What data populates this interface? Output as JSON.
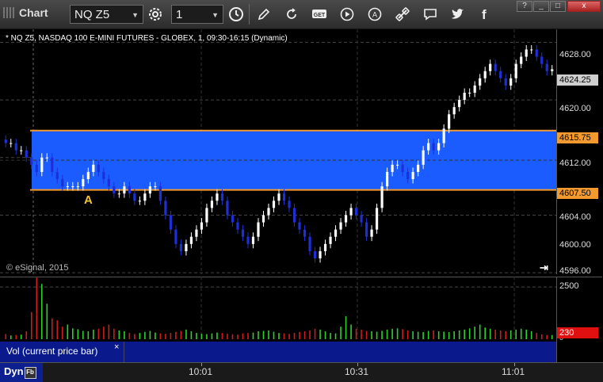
{
  "window": {
    "title": "Chart",
    "symbol": "NQ Z5",
    "interval": "1",
    "controls": {
      "help": "?",
      "minimize": "_",
      "maximize": "□",
      "close": "x"
    },
    "toolbar_icons": [
      "gear-icon",
      "clock-icon",
      "pencil-icon",
      "refresh-icon",
      "get-icon",
      "play-icon",
      "replay-icon",
      "link-icon",
      "comment-icon",
      "twitter-icon",
      "facebook-icon"
    ],
    "toolbar_icon_texts": {
      "get": "GET",
      "replay": "A",
      "facebook": "f"
    }
  },
  "chart": {
    "header": "* NQ Z5, NASDAQ 100 E-MINI FUTURES - GLOBEX, 1, 09:30-16:15 (Dynamic)",
    "copyright": "© eSignal, 2015",
    "marker_label": "A",
    "pan_icon": "⇥",
    "price_scale": [
      "4628.00",
      "4620.00",
      "4612.00",
      "4604.00",
      "4600.00",
      "4596.00"
    ],
    "current_price": "4624.25",
    "level_high": "4615.75",
    "level_low": "4607.50",
    "volume_scale": [
      "2500",
      "0"
    ],
    "current_volume": "230",
    "time_labels": [
      "10:01",
      "10:31",
      "11:01"
    ],
    "colors": {
      "zone": "#1a5cff",
      "level_line": "#f39a2e",
      "up_candle": "#ffffff",
      "down_candle": "#1f2fd8",
      "vol_up": "#2cd12c",
      "vol_down": "#d11b1b"
    }
  },
  "chart_data": {
    "type": "candlestick",
    "y_range": [
      4595.8,
      4629.8
    ],
    "volume_range": [
      0,
      3000
    ],
    "open_range_high": 4615.75,
    "open_range_low": 4607.5,
    "bar_count": 105,
    "closes": [
      4614,
      4614,
      4613,
      4613,
      4612,
      4611,
      4610,
      4612,
      4612,
      4610,
      4609,
      4608,
      4608,
      4608,
      4608,
      4609,
      4610,
      4611,
      4610,
      4609,
      4608,
      4607,
      4607,
      4608,
      4607,
      4606,
      4606,
      4607,
      4608,
      4608,
      4606,
      4604,
      4602,
      4600,
      4599,
      4600,
      4601,
      4602,
      4603,
      4605,
      4606,
      4607,
      4606,
      4604,
      4603,
      4602,
      4601,
      4600,
      4601,
      4603,
      4604,
      4605,
      4606,
      4607,
      4606,
      4605,
      4603,
      4602,
      4601,
      4599,
      4598,
      4599,
      4600,
      4601,
      4602,
      4603,
      4604,
      4605,
      4604,
      4603,
      4601,
      4602,
      4605,
      4608,
      4610,
      4611,
      4611,
      4610,
      4609,
      4610,
      4611,
      4613,
      4614,
      4613,
      4614,
      4616,
      4618,
      4619,
      4620,
      4621,
      4621,
      4622,
      4623,
      4624,
      4625,
      4624,
      4623,
      4622,
      4623,
      4625,
      4626,
      4627,
      4627,
      4626,
      4625,
      4624,
      4624.25
    ],
    "volumes": [
      250,
      180,
      200,
      220,
      380,
      1300,
      2950,
      2650,
      1700,
      1000,
      900,
      600,
      700,
      520,
      480,
      400,
      380,
      460,
      500,
      600,
      700,
      500,
      420,
      380,
      300,
      250,
      300,
      350,
      400,
      320,
      280,
      260,
      300,
      350,
      400,
      460,
      380,
      300,
      260,
      240,
      280,
      320,
      300,
      260,
      240,
      220,
      280,
      300,
      320,
      380,
      400,
      420,
      360,
      300,
      280,
      260,
      300,
      350,
      380,
      420,
      500,
      460,
      380,
      300,
      280,
      600,
      1100,
      700,
      500,
      450,
      400,
      380,
      360,
      400,
      460,
      500,
      520,
      480,
      420,
      380,
      360,
      340,
      400,
      420,
      380,
      360,
      340,
      380,
      420,
      460,
      520,
      600,
      700,
      560,
      500,
      460,
      420,
      380,
      420,
      460,
      500,
      460,
      380,
      300,
      230
    ]
  }
}
